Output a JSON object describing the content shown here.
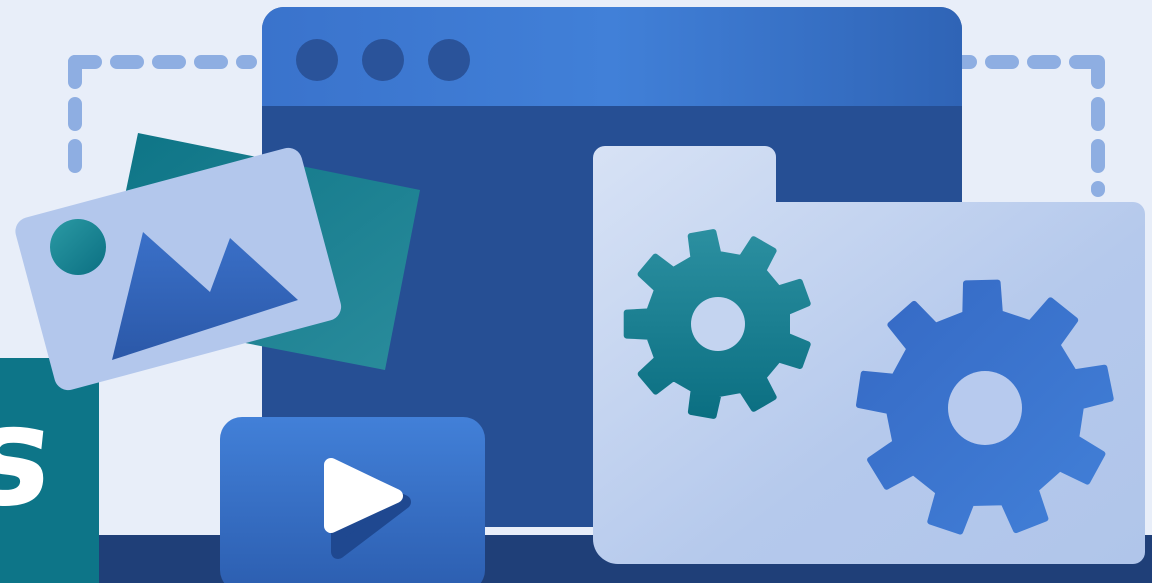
{
  "banner": {
    "partial_text": "s"
  },
  "icons": {
    "window": "browser-window-icon",
    "image": "image-card-icon",
    "video": "play-button-icon",
    "folder": "folder-icon",
    "gear_small": "gear-icon",
    "gear_large": "gear-icon"
  },
  "colors": {
    "background": "#e8eef9",
    "window_header": "#3d78d1",
    "window_body": "#264f94",
    "footer_bar": "#1f3f78",
    "teal": "#0f7f8e",
    "folder": "#b7cbec",
    "accent_blue": "#3e79d2"
  }
}
